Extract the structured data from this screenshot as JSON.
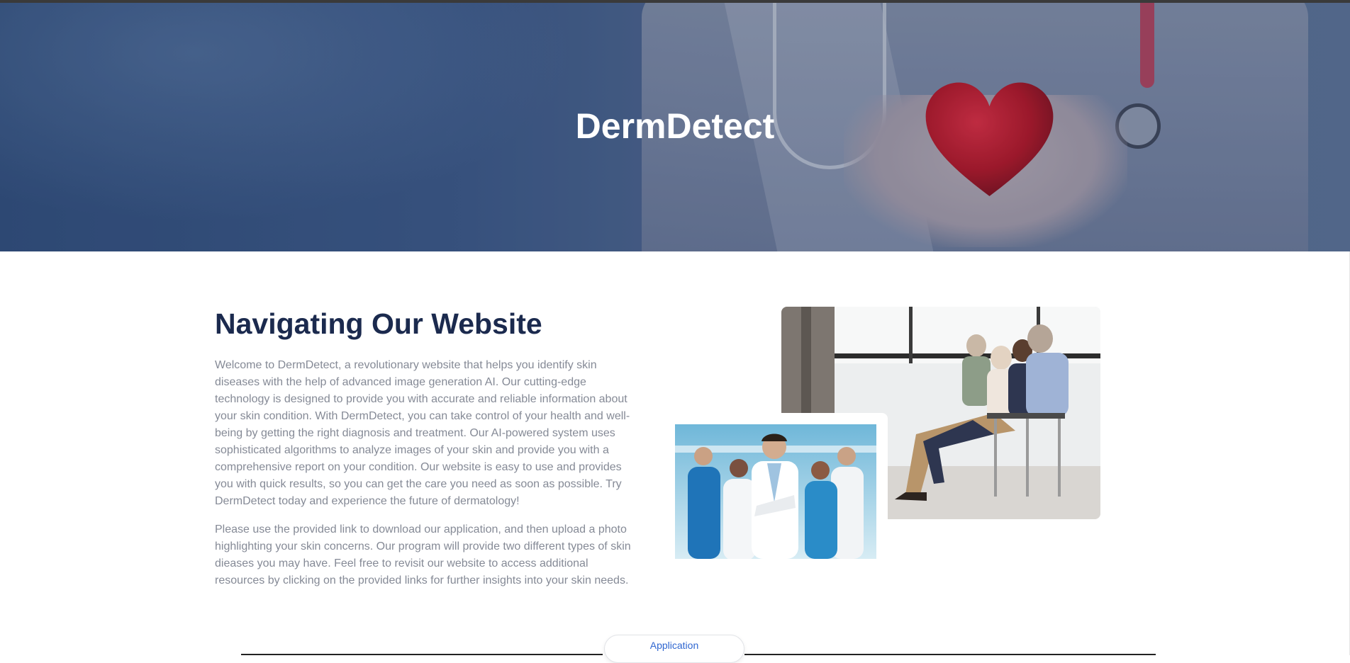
{
  "hero": {
    "title": "DermDetect"
  },
  "about": {
    "heading": "Navigating Our Website",
    "paragraph1": "Welcome to DermDetect, a revolutionary website that helps you identify skin diseases with the help of advanced image generation AI. Our cutting-edge technology is designed to provide you with accurate and reliable information about your skin condition. With DermDetect, you can take control of your health and well-being by getting the right diagnosis and treatment. Our AI-powered system uses sophisticated algorithms to analyze images of your skin and provide you with a comprehensive report on your condition. Our website is easy to use and provides you with quick results, so you can get the care you need as soon as possible. Try DermDetect today and experience the future of dermatology!",
    "paragraph2": "Please use the provided link to download our application, and then upload a photo highlighting your skin concerns. Our program will provide two different types of skin dieases you may have. Feel free to revisit our website to access additional resources by clicking on the provided links for further insights into your skin needs."
  },
  "buttons": {
    "application_label": "Application"
  },
  "colors": {
    "heading": "#1b2a4e",
    "body_text": "#858a96",
    "link": "#2f66d0",
    "hero_blue": "#2f4b77"
  }
}
